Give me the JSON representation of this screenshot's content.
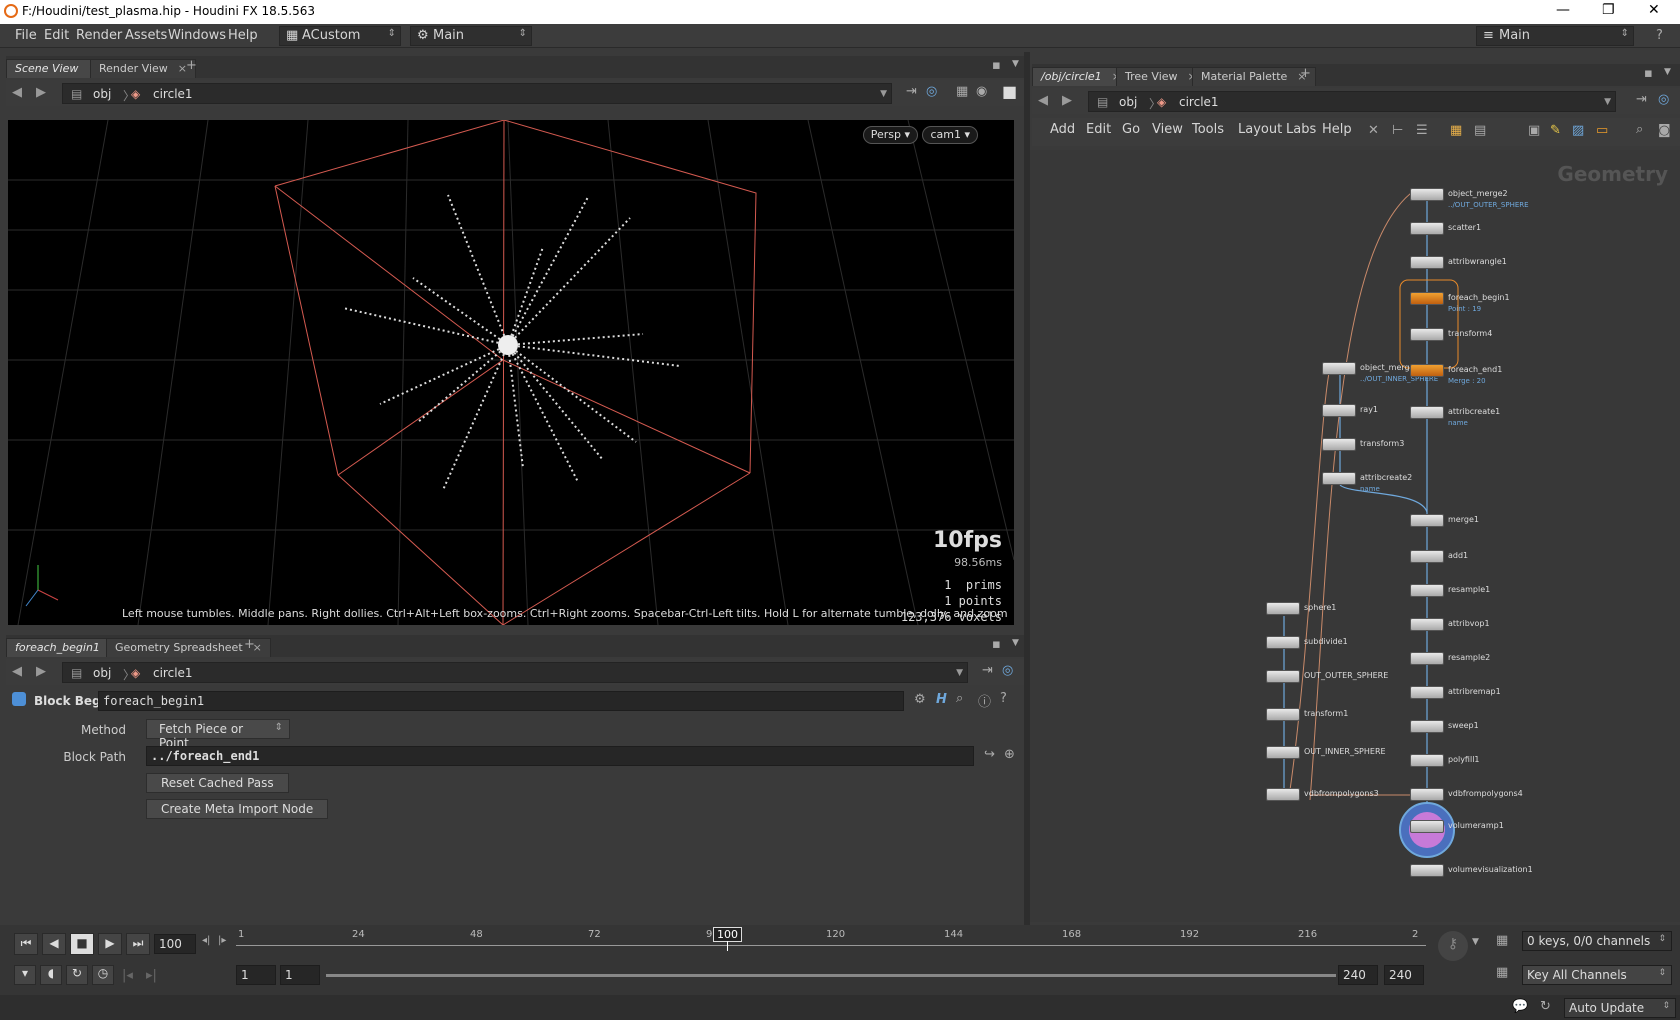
{
  "window": {
    "title": "F:/Houdini/test_plasma.hip - Houdini FX 18.5.563",
    "controls": [
      "—",
      "❐",
      "✕"
    ]
  },
  "menubar": {
    "items": [
      "File",
      "Edit",
      "Render",
      "Assets",
      "Windows",
      "Help"
    ],
    "desktop": "ACustom",
    "context": "Main",
    "right_context": "Main"
  },
  "scene_pane": {
    "tabs": [
      "Scene View",
      "Render View"
    ],
    "path": [
      "obj",
      "circle1"
    ],
    "persp": "Persp ▾",
    "camera": "cam1 ▾",
    "fps": "10fps",
    "ms": "98.56ms",
    "stats": [
      "1  prims",
      "1 points",
      "123,376 voxels"
    ],
    "hint": "Left mouse tumbles. Middle pans. Right dollies. Ctrl+Alt+Left box-zooms. Ctrl+Right zooms. Spacebar-Ctrl-Left tilts. Hold L for alternate tumble, dolly, and zoom"
  },
  "param_pane": {
    "tabs": [
      "foreach_begin1",
      "Geometry Spreadsheet"
    ],
    "path": [
      "obj",
      "circle1"
    ],
    "node_type": "Block Begin",
    "node_name": "foreach_begin1",
    "method_label": "Method",
    "method_value": "Fetch Piece or Point",
    "block_path_label": "Block Path",
    "block_path_value": "../foreach_end1",
    "reset_button": "Reset Cached Pass",
    "create_button": "Create Meta Import Node"
  },
  "network_pane": {
    "tabs": [
      "/obj/circle1",
      "Tree View",
      "Material Palette"
    ],
    "path": [
      "obj",
      "circle1"
    ],
    "menu": [
      "Add",
      "Edit",
      "Go",
      "View",
      "Tools",
      "Layout",
      "Labs",
      "Help"
    ],
    "watermark": "Geometry",
    "nodes": [
      {
        "name": "object_merge2",
        "sub": "../OUT_OUTER_SPHERE"
      },
      {
        "name": "scatter1",
        "sub": ""
      },
      {
        "name": "attribwrangle1",
        "sub": ""
      },
      {
        "name": "foreach_begin1",
        "sub": "Point : 19"
      },
      {
        "name": "transform4",
        "sub": ""
      },
      {
        "name": "object_merge1",
        "sub": "../OUT_INNER_SPHERE"
      },
      {
        "name": "foreach_end1",
        "sub": "Merge : 20"
      },
      {
        "name": "ray1",
        "sub": ""
      },
      {
        "name": "attribcreate1",
        "sub": "name"
      },
      {
        "name": "transform3",
        "sub": ""
      },
      {
        "name": "attribcreate2",
        "sub": "name"
      },
      {
        "name": "merge1",
        "sub": ""
      },
      {
        "name": "add1",
        "sub": ""
      },
      {
        "name": "resample1",
        "sub": ""
      },
      {
        "name": "sphere1",
        "sub": ""
      },
      {
        "name": "attribvop1",
        "sub": ""
      },
      {
        "name": "subdivide1",
        "sub": ""
      },
      {
        "name": "resample2",
        "sub": ""
      },
      {
        "name": "OUT_OUTER_SPHERE",
        "sub": ""
      },
      {
        "name": "attribremap1",
        "sub": ""
      },
      {
        "name": "transform1",
        "sub": ""
      },
      {
        "name": "sweep1",
        "sub": ""
      },
      {
        "name": "OUT_INNER_SPHERE",
        "sub": ""
      },
      {
        "name": "polyfill1",
        "sub": ""
      },
      {
        "name": "vdbfrompolygons3",
        "sub": ""
      },
      {
        "name": "vdbfrompolygons4",
        "sub": ""
      },
      {
        "name": "volumeramp1",
        "sub": ""
      },
      {
        "name": "volumevisualization1",
        "sub": ""
      }
    ]
  },
  "timeline": {
    "frame": "100",
    "current_marker": "100",
    "ticks": [
      "1",
      "24",
      "48",
      "72",
      "9",
      "120",
      "144",
      "168",
      "192",
      "216",
      "2"
    ],
    "start": "1",
    "start2": "1",
    "end": "240",
    "end2": "240",
    "keys": "0 keys, 0/0 channels",
    "key_mode": "Key All Channels"
  },
  "status": {
    "update_mode": "Auto Update"
  },
  "colors": {
    "accent_orange": "#e56a16",
    "selection_blue": "#6fa8dc",
    "viewport_bg": "#000000"
  }
}
